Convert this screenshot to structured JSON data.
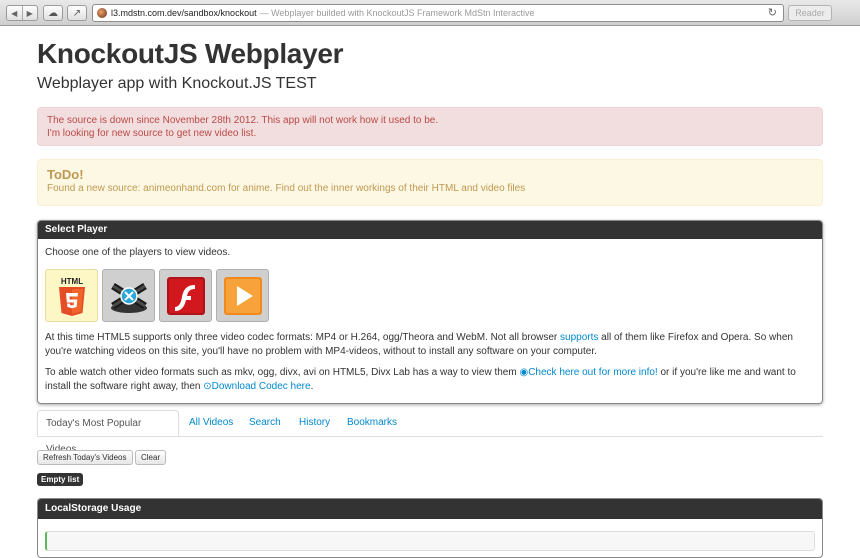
{
  "browser": {
    "back": "◀",
    "forward": "▶",
    "url_main": "l3.mdstn.com.dev/sandbox/knockout",
    "url_rest": "— Webplayer builded with KnockoutJS Framework MdStn Interactive",
    "reader": "Reader",
    "reload": "↻"
  },
  "header": {
    "title": "KnockoutJS Webplayer",
    "subtitle": "Webplayer app with Knockout.JS TEST"
  },
  "alerts": {
    "error_line1": "The source is down since November 28th 2012. This app will not work how it used to be.",
    "error_line2": "I'm looking for new source to get new video list.",
    "todo_title": "ToDo!",
    "todo_text": "Found a new source: animeonhand.com for anime. Find out the inner workings of their HTML and video files"
  },
  "player_panel": {
    "title": "Select Player",
    "intro": "Choose one of the players to view videos.",
    "html5_label": "HTML",
    "p1_a": "At this time HTML5 supports only three video codec formats: MP4 or H.264, ogg/Theora and WebM. Not all browser ",
    "p1_link": "supports",
    "p1_b": " all of them like Firefox and Opera. So when you're watching videos on this site, you'll have no problem with MP4-videos, without to install any software on your computer.",
    "p2_a": "To able watch other video formats such as mkv, ogg, divx, avi on HTML5, Divx Lab has a way to view them ",
    "p2_link1": "Check here out for more info!",
    "p2_b": " or if you're like me and want to install the software right away, then ",
    "p2_link2": "Download Codec here",
    "p2_c": "."
  },
  "tabs": [
    "Today's Most Popular Videos",
    "All Videos",
    "Search",
    "History",
    "Bookmarks"
  ],
  "buttons": {
    "refresh": "Refresh Today's Videos",
    "clear": "Clear",
    "empty": "Empty list"
  },
  "storage_panel": {
    "title": "LocalStorage Usage"
  },
  "colors": {
    "link": "#0088cc",
    "error_text": "#b94a48",
    "warn_text": "#c09853",
    "panel_head": "#333333"
  }
}
